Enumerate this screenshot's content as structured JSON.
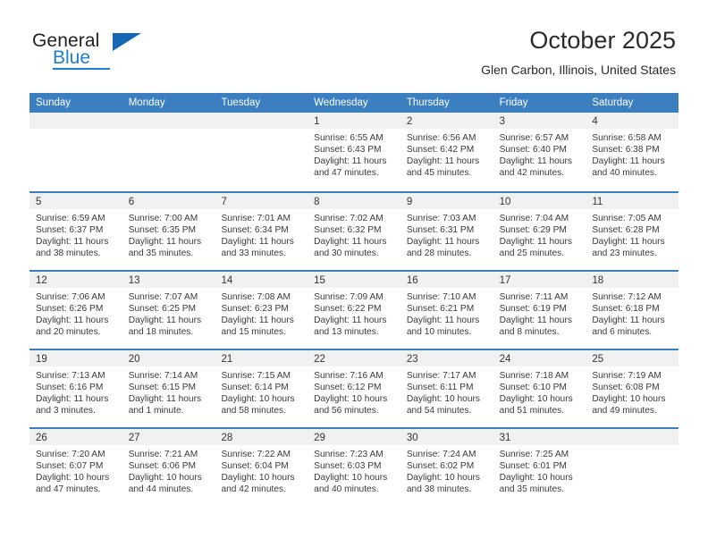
{
  "brand": {
    "name_part1": "General",
    "name_part2": "Blue",
    "logo_icon": "triangle-logo-icon"
  },
  "header": {
    "title": "October 2025",
    "location": "Glen Carbon, Illinois, United States"
  },
  "colors": {
    "header_blue": "#3c7fc0",
    "brand_blue": "#1c7fd1",
    "daynum_band": "#f1f1f1",
    "text": "#3a3a3a"
  },
  "weekdays": [
    "Sunday",
    "Monday",
    "Tuesday",
    "Wednesday",
    "Thursday",
    "Friday",
    "Saturday"
  ],
  "weeks": [
    [
      {
        "day": "",
        "empty": true,
        "sunrise": "",
        "sunset": "",
        "daylight_line1": "",
        "daylight_line2": ""
      },
      {
        "day": "",
        "empty": true,
        "sunrise": "",
        "sunset": "",
        "daylight_line1": "",
        "daylight_line2": ""
      },
      {
        "day": "",
        "empty": true,
        "sunrise": "",
        "sunset": "",
        "daylight_line1": "",
        "daylight_line2": ""
      },
      {
        "day": "1",
        "empty": false,
        "sunrise": "Sunrise: 6:55 AM",
        "sunset": "Sunset: 6:43 PM",
        "daylight_line1": "Daylight: 11 hours",
        "daylight_line2": "and 47 minutes."
      },
      {
        "day": "2",
        "empty": false,
        "sunrise": "Sunrise: 6:56 AM",
        "sunset": "Sunset: 6:42 PM",
        "daylight_line1": "Daylight: 11 hours",
        "daylight_line2": "and 45 minutes."
      },
      {
        "day": "3",
        "empty": false,
        "sunrise": "Sunrise: 6:57 AM",
        "sunset": "Sunset: 6:40 PM",
        "daylight_line1": "Daylight: 11 hours",
        "daylight_line2": "and 42 minutes."
      },
      {
        "day": "4",
        "empty": false,
        "sunrise": "Sunrise: 6:58 AM",
        "sunset": "Sunset: 6:38 PM",
        "daylight_line1": "Daylight: 11 hours",
        "daylight_line2": "and 40 minutes."
      }
    ],
    [
      {
        "day": "5",
        "empty": false,
        "sunrise": "Sunrise: 6:59 AM",
        "sunset": "Sunset: 6:37 PM",
        "daylight_line1": "Daylight: 11 hours",
        "daylight_line2": "and 38 minutes."
      },
      {
        "day": "6",
        "empty": false,
        "sunrise": "Sunrise: 7:00 AM",
        "sunset": "Sunset: 6:35 PM",
        "daylight_line1": "Daylight: 11 hours",
        "daylight_line2": "and 35 minutes."
      },
      {
        "day": "7",
        "empty": false,
        "sunrise": "Sunrise: 7:01 AM",
        "sunset": "Sunset: 6:34 PM",
        "daylight_line1": "Daylight: 11 hours",
        "daylight_line2": "and 33 minutes."
      },
      {
        "day": "8",
        "empty": false,
        "sunrise": "Sunrise: 7:02 AM",
        "sunset": "Sunset: 6:32 PM",
        "daylight_line1": "Daylight: 11 hours",
        "daylight_line2": "and 30 minutes."
      },
      {
        "day": "9",
        "empty": false,
        "sunrise": "Sunrise: 7:03 AM",
        "sunset": "Sunset: 6:31 PM",
        "daylight_line1": "Daylight: 11 hours",
        "daylight_line2": "and 28 minutes."
      },
      {
        "day": "10",
        "empty": false,
        "sunrise": "Sunrise: 7:04 AM",
        "sunset": "Sunset: 6:29 PM",
        "daylight_line1": "Daylight: 11 hours",
        "daylight_line2": "and 25 minutes."
      },
      {
        "day": "11",
        "empty": false,
        "sunrise": "Sunrise: 7:05 AM",
        "sunset": "Sunset: 6:28 PM",
        "daylight_line1": "Daylight: 11 hours",
        "daylight_line2": "and 23 minutes."
      }
    ],
    [
      {
        "day": "12",
        "empty": false,
        "sunrise": "Sunrise: 7:06 AM",
        "sunset": "Sunset: 6:26 PM",
        "daylight_line1": "Daylight: 11 hours",
        "daylight_line2": "and 20 minutes."
      },
      {
        "day": "13",
        "empty": false,
        "sunrise": "Sunrise: 7:07 AM",
        "sunset": "Sunset: 6:25 PM",
        "daylight_line1": "Daylight: 11 hours",
        "daylight_line2": "and 18 minutes."
      },
      {
        "day": "14",
        "empty": false,
        "sunrise": "Sunrise: 7:08 AM",
        "sunset": "Sunset: 6:23 PM",
        "daylight_line1": "Daylight: 11 hours",
        "daylight_line2": "and 15 minutes."
      },
      {
        "day": "15",
        "empty": false,
        "sunrise": "Sunrise: 7:09 AM",
        "sunset": "Sunset: 6:22 PM",
        "daylight_line1": "Daylight: 11 hours",
        "daylight_line2": "and 13 minutes."
      },
      {
        "day": "16",
        "empty": false,
        "sunrise": "Sunrise: 7:10 AM",
        "sunset": "Sunset: 6:21 PM",
        "daylight_line1": "Daylight: 11 hours",
        "daylight_line2": "and 10 minutes."
      },
      {
        "day": "17",
        "empty": false,
        "sunrise": "Sunrise: 7:11 AM",
        "sunset": "Sunset: 6:19 PM",
        "daylight_line1": "Daylight: 11 hours",
        "daylight_line2": "and 8 minutes."
      },
      {
        "day": "18",
        "empty": false,
        "sunrise": "Sunrise: 7:12 AM",
        "sunset": "Sunset: 6:18 PM",
        "daylight_line1": "Daylight: 11 hours",
        "daylight_line2": "and 6 minutes."
      }
    ],
    [
      {
        "day": "19",
        "empty": false,
        "sunrise": "Sunrise: 7:13 AM",
        "sunset": "Sunset: 6:16 PM",
        "daylight_line1": "Daylight: 11 hours",
        "daylight_line2": "and 3 minutes."
      },
      {
        "day": "20",
        "empty": false,
        "sunrise": "Sunrise: 7:14 AM",
        "sunset": "Sunset: 6:15 PM",
        "daylight_line1": "Daylight: 11 hours",
        "daylight_line2": "and 1 minute."
      },
      {
        "day": "21",
        "empty": false,
        "sunrise": "Sunrise: 7:15 AM",
        "sunset": "Sunset: 6:14 PM",
        "daylight_line1": "Daylight: 10 hours",
        "daylight_line2": "and 58 minutes."
      },
      {
        "day": "22",
        "empty": false,
        "sunrise": "Sunrise: 7:16 AM",
        "sunset": "Sunset: 6:12 PM",
        "daylight_line1": "Daylight: 10 hours",
        "daylight_line2": "and 56 minutes."
      },
      {
        "day": "23",
        "empty": false,
        "sunrise": "Sunrise: 7:17 AM",
        "sunset": "Sunset: 6:11 PM",
        "daylight_line1": "Daylight: 10 hours",
        "daylight_line2": "and 54 minutes."
      },
      {
        "day": "24",
        "empty": false,
        "sunrise": "Sunrise: 7:18 AM",
        "sunset": "Sunset: 6:10 PM",
        "daylight_line1": "Daylight: 10 hours",
        "daylight_line2": "and 51 minutes."
      },
      {
        "day": "25",
        "empty": false,
        "sunrise": "Sunrise: 7:19 AM",
        "sunset": "Sunset: 6:08 PM",
        "daylight_line1": "Daylight: 10 hours",
        "daylight_line2": "and 49 minutes."
      }
    ],
    [
      {
        "day": "26",
        "empty": false,
        "sunrise": "Sunrise: 7:20 AM",
        "sunset": "Sunset: 6:07 PM",
        "daylight_line1": "Daylight: 10 hours",
        "daylight_line2": "and 47 minutes."
      },
      {
        "day": "27",
        "empty": false,
        "sunrise": "Sunrise: 7:21 AM",
        "sunset": "Sunset: 6:06 PM",
        "daylight_line1": "Daylight: 10 hours",
        "daylight_line2": "and 44 minutes."
      },
      {
        "day": "28",
        "empty": false,
        "sunrise": "Sunrise: 7:22 AM",
        "sunset": "Sunset: 6:04 PM",
        "daylight_line1": "Daylight: 10 hours",
        "daylight_line2": "and 42 minutes."
      },
      {
        "day": "29",
        "empty": false,
        "sunrise": "Sunrise: 7:23 AM",
        "sunset": "Sunset: 6:03 PM",
        "daylight_line1": "Daylight: 10 hours",
        "daylight_line2": "and 40 minutes."
      },
      {
        "day": "30",
        "empty": false,
        "sunrise": "Sunrise: 7:24 AM",
        "sunset": "Sunset: 6:02 PM",
        "daylight_line1": "Daylight: 10 hours",
        "daylight_line2": "and 38 minutes."
      },
      {
        "day": "31",
        "empty": false,
        "sunrise": "Sunrise: 7:25 AM",
        "sunset": "Sunset: 6:01 PM",
        "daylight_line1": "Daylight: 10 hours",
        "daylight_line2": "and 35 minutes."
      },
      {
        "day": "",
        "empty": true,
        "sunrise": "",
        "sunset": "",
        "daylight_line1": "",
        "daylight_line2": ""
      }
    ]
  ]
}
